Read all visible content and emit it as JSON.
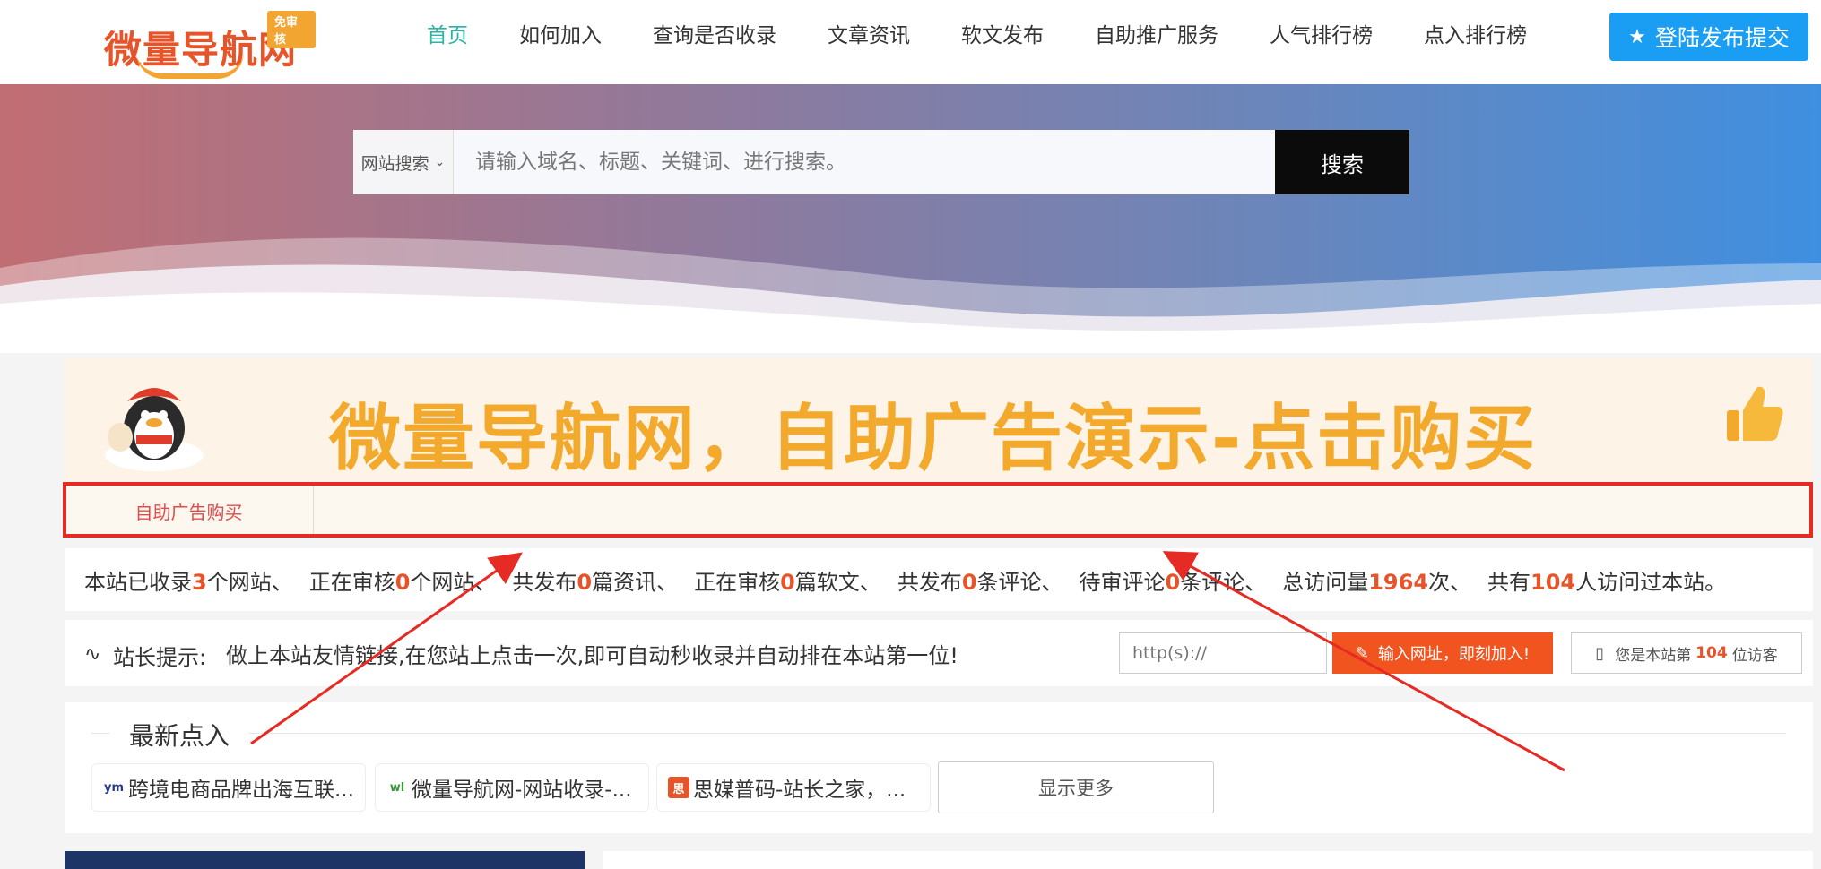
{
  "header": {
    "logo_text": "微量导航网",
    "logo_badge": "免审核",
    "nav": [
      "首页",
      "如何加入",
      "查询是否收录",
      "文章资讯",
      "软文发布",
      "自助推广服务",
      "人气排行榜",
      "点入排行榜"
    ],
    "active_nav": "首页",
    "login_label": "登陆发布提交"
  },
  "search": {
    "select_label": "网站搜索",
    "placeholder": "请输入域名、标题、关键词、进行搜索。",
    "button_label": "搜索"
  },
  "ad": {
    "text": "微量导航网，自助广告演示-点击购买",
    "tab_label": "自助广告购买"
  },
  "stats": {
    "p1": "本站已收录",
    "v1": "3",
    "s1": "个网站、",
    "p2": "正在审核",
    "v2": "0",
    "s2": "个网站、",
    "p3": "共发布",
    "v3": "0",
    "s3": "篇资讯、",
    "p4": "正在审核",
    "v4": "0",
    "s4": "篇软文、",
    "p5": "共发布",
    "v5": "0",
    "s5": "条评论、",
    "p6": "待审评论",
    "v6": "0",
    "s6": "条评论、",
    "p7": "总访问量",
    "v7": "1964",
    "s7": "次、",
    "p8": "共有",
    "v8": "104",
    "s8": "人访问过本站。"
  },
  "tip": {
    "label": "站长提示:",
    "text": "做上本站友情链接,在您站上点击一次,即可自动秒收录并自动排在本站第一位!",
    "input_placeholder": "http(s)://",
    "button_label": "输入网址，即刻加入!",
    "visitor_prefix": "您是本站第",
    "visitor_count": "104",
    "visitor_suffix": "位访客"
  },
  "latest": {
    "title": "最新点入",
    "items": [
      {
        "icon": "ym",
        "label": "跨境电商品牌出海互联..."
      },
      {
        "icon": "wl",
        "label": "微量导航网-网站收录-..."
      },
      {
        "icon": "思",
        "label": "思媒普码-站长之家，..."
      }
    ],
    "more_label": "显示更多"
  },
  "colors": {
    "accent": "#2bb3a3",
    "login": "#1a9ef3",
    "highlight": "#e8542a",
    "annotation": "#e52b23"
  }
}
